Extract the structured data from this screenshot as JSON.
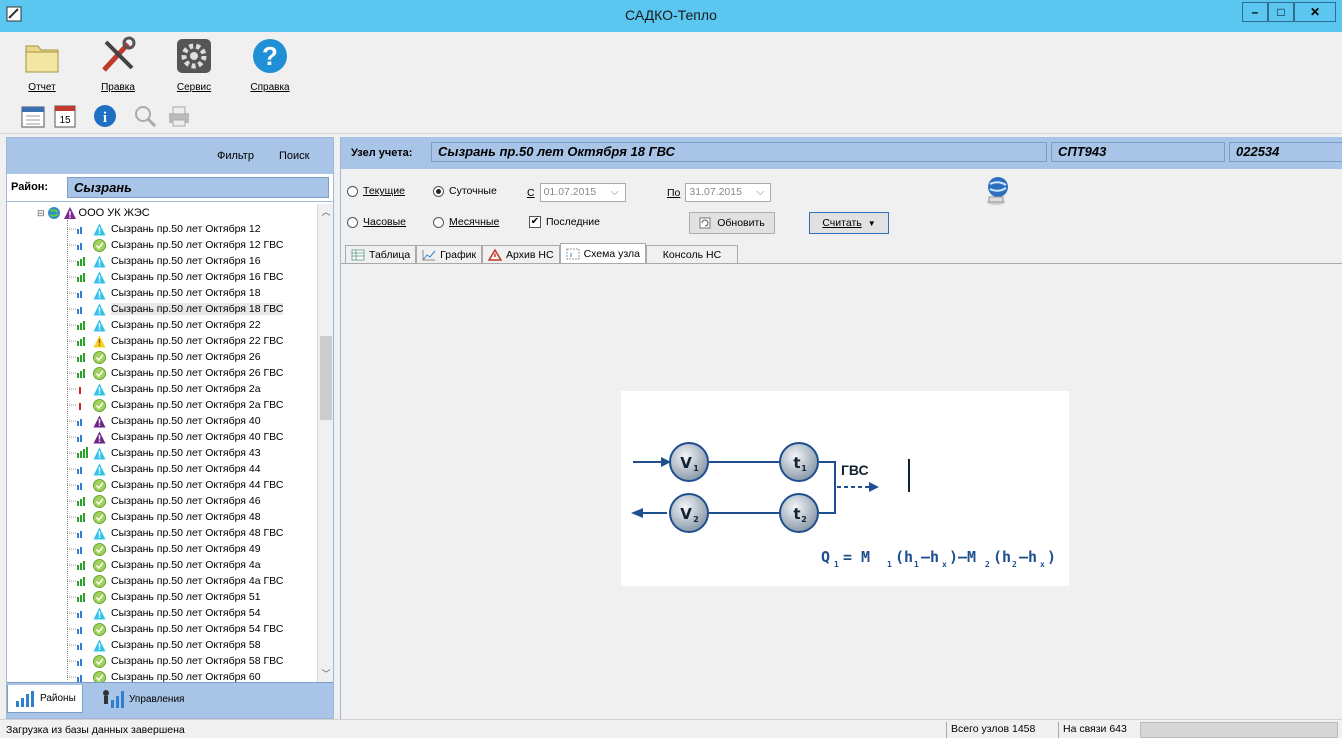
{
  "window": {
    "title": "САДКО-Тепло"
  },
  "toolbar_big": [
    {
      "label": "Отчет",
      "icon": "folder-icon"
    },
    {
      "label": "Правка",
      "icon": "tools-icon"
    },
    {
      "label": "Сервис",
      "icon": "gear-icon"
    },
    {
      "label": "Справка",
      "icon": "help-icon"
    }
  ],
  "toolbar_small": [
    "calendar-icon",
    "calendar-15-icon",
    "info-icon",
    "search-icon",
    "print-icon"
  ],
  "left": {
    "filter_label": "Фильтр",
    "search_label": "Поиск",
    "district_label": "Район:",
    "district_value": "Сызрань",
    "root_label": "ООО УК ЖЭС",
    "items": [
      {
        "label": "Сызрань пр.50 лет Октября 12",
        "status": "warn-cyan",
        "signal": 2
      },
      {
        "label": "Сызрань пр.50 лет Октября 12 ГВС",
        "status": "ok",
        "signal": 2
      },
      {
        "label": "Сызрань пр.50 лет Октября 16",
        "status": "warn-cyan",
        "signal": 3
      },
      {
        "label": "Сызрань пр.50 лет Октября 16 ГВС",
        "status": "warn-cyan",
        "signal": 3
      },
      {
        "label": "Сызрань пр.50 лет Октября 18",
        "status": "warn-cyan",
        "signal": 2
      },
      {
        "label": "Сызрань пр.50 лет Октября 18 ГВС",
        "status": "warn-cyan",
        "signal": 2,
        "selected": true
      },
      {
        "label": "Сызрань пр.50 лет Октября 22",
        "status": "warn-cyan",
        "signal": 3
      },
      {
        "label": "Сызрань пр.50 лет Октября 22 ГВС",
        "status": "warn-yellow",
        "signal": 3
      },
      {
        "label": "Сызрань пр.50 лет Октября 26",
        "status": "ok",
        "signal": 3
      },
      {
        "label": "Сызрань пр.50 лет Октября 26 ГВС",
        "status": "ok",
        "signal": 3
      },
      {
        "label": "Сызрань пр.50 лет Октября 2а",
        "status": "warn-cyan",
        "signal": 1
      },
      {
        "label": "Сызрань пр.50 лет Октября 2а ГВС",
        "status": "ok",
        "signal": 1
      },
      {
        "label": "Сызрань пр.50 лет Октября 40",
        "status": "alarm",
        "signal": 2
      },
      {
        "label": "Сызрань пр.50 лет Октября 40 ГВС",
        "status": "alarm",
        "signal": 2
      },
      {
        "label": "Сызрань пр.50 лет Октября 43",
        "status": "warn-cyan",
        "signal": 4
      },
      {
        "label": "Сызрань пр.50 лет Октября 44",
        "status": "warn-cyan",
        "signal": 2
      },
      {
        "label": "Сызрань пр.50 лет Октября 44 ГВС",
        "status": "ok",
        "signal": 2
      },
      {
        "label": "Сызрань пр.50 лет Октября 46",
        "status": "ok",
        "signal": 3
      },
      {
        "label": "Сызрань пр.50 лет Октября 48",
        "status": "ok",
        "signal": 3
      },
      {
        "label": "Сызрань пр.50 лет Октября 48 ГВС",
        "status": "warn-cyan",
        "signal": 2
      },
      {
        "label": "Сызрань пр.50 лет Октября 49",
        "status": "ok",
        "signal": 2
      },
      {
        "label": "Сызрань пр.50 лет Октября 4а",
        "status": "ok",
        "signal": 3
      },
      {
        "label": "Сызрань пр.50 лет Октября 4а ГВС",
        "status": "ok",
        "signal": 3
      },
      {
        "label": "Сызрань пр.50 лет Октября 51",
        "status": "ok",
        "signal": 3
      },
      {
        "label": "Сызрань пр.50 лет Октября 54",
        "status": "warn-cyan",
        "signal": 2
      },
      {
        "label": "Сызрань пр.50 лет Октября 54 ГВС",
        "status": "ok",
        "signal": 2
      },
      {
        "label": "Сызрань пр.50 лет Октября 58",
        "status": "warn-cyan",
        "signal": 2
      },
      {
        "label": "Сызрань пр.50 лет Октября 58 ГВС",
        "status": "ok",
        "signal": 2
      },
      {
        "label": "Сызрань пр.50 лет Октября 60",
        "status": "ok",
        "signal": 2
      }
    ],
    "tabs": [
      "Районы",
      "Управления"
    ]
  },
  "right": {
    "node_label": "Узел учета:",
    "node_name": "Сызрань пр.50 лет Октября 18 ГВС",
    "device": "СПТ943",
    "serial": "022534",
    "radio_current": "Текущие",
    "radio_daily": "Суточные",
    "radio_hourly": "Часовые",
    "radio_monthly": "Месячные",
    "from_label": "С",
    "from_date": "01.07.2015",
    "to_label": "По",
    "to_date": "31.07.2015",
    "last_label": "Последние",
    "refresh_label": "Обновить",
    "read_label": "Считать",
    "tabs": [
      "Таблица",
      "График",
      "Архив НС",
      "Схема узла",
      "Консоль НС"
    ],
    "scheme": {
      "v1": "V",
      "v2": "V",
      "t1": "t",
      "t2": "t",
      "sub1": "1",
      "sub2": "2",
      "gvs": "ГВС"
    }
  },
  "status": {
    "message": "Загрузка из базы данных завершена",
    "total_label": "Всего узлов",
    "total_value": "1458",
    "online_label": "На связи",
    "online_value": "643"
  }
}
